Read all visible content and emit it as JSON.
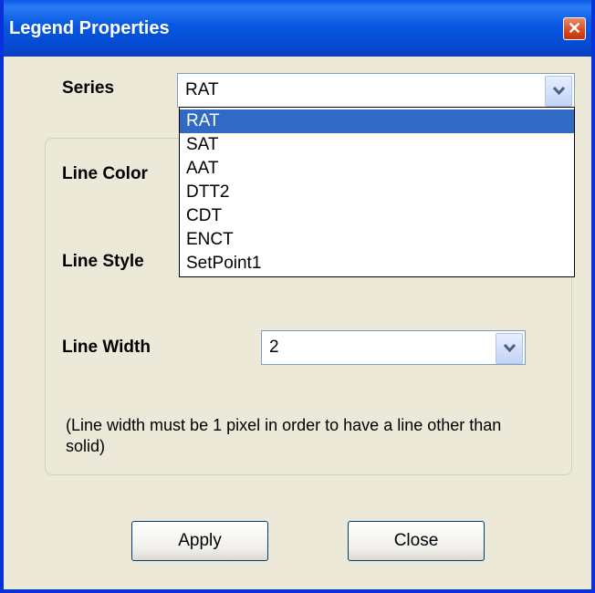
{
  "window": {
    "title": "Legend Properties",
    "close_glyph": "✕"
  },
  "series": {
    "label": "Series",
    "value": "RAT",
    "options": [
      "RAT",
      "SAT",
      "AAT",
      "DTT2",
      "CDT",
      "ENCT",
      "SetPoint1"
    ],
    "selected_index": 0
  },
  "line_color": {
    "label": "Line Color"
  },
  "line_style": {
    "label": "Line Style"
  },
  "line_width": {
    "label": "Line Width",
    "value": "2"
  },
  "note": "(Line width must be 1 pixel in order to have a line other than solid)",
  "buttons": {
    "apply": "Apply",
    "close": "Close"
  },
  "colors": {
    "title_bar": "#0a5ae6",
    "selection": "#316ac5",
    "face": "#ece9d8"
  },
  "icons": {
    "close": "close-icon",
    "dropdown": "chevron-down-icon"
  }
}
